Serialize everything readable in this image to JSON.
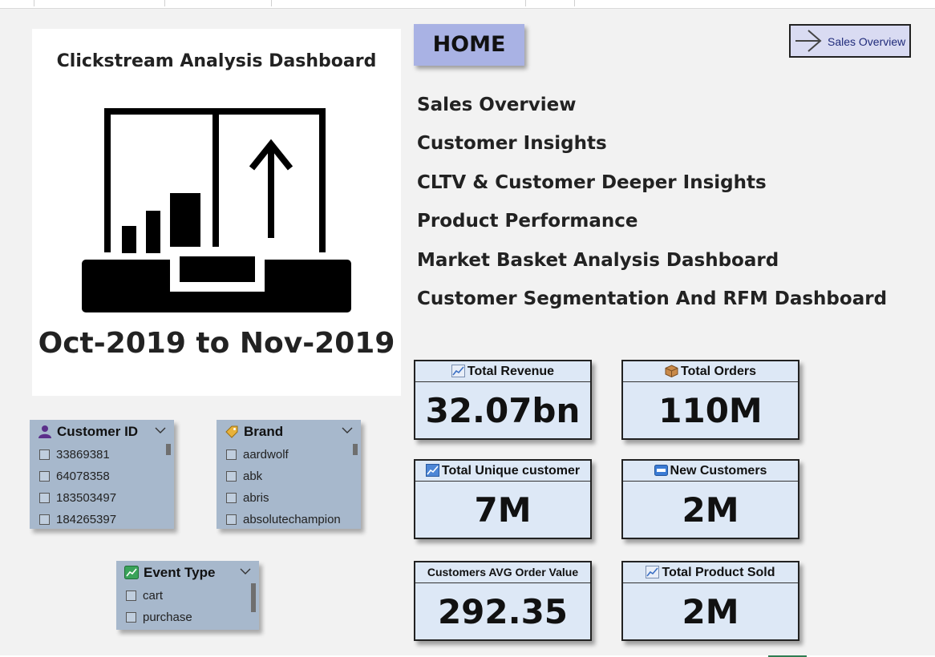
{
  "logo_card": {
    "title": "Clickstream Analysis Dashboard",
    "date_range": "Oct-2019 to Nov-2019",
    "logo_icon": "chart-growth-icon"
  },
  "home_label": "HOME",
  "nav_button": {
    "label": "Sales Overview",
    "icon": "arrow-right-icon"
  },
  "page_links": [
    "Sales Overview",
    "Customer Insights",
    "CLTV & Customer Deeper Insights",
    "Product Performance",
    "Market Basket Analysis Dashboard",
    "Customer Segmentation And RFM Dashboard"
  ],
  "kpis": [
    {
      "label": "Total Revenue",
      "value": "32.07bn",
      "icon": "chart-up-icon"
    },
    {
      "label": "Total Orders",
      "value": "110M",
      "icon": "package-icon"
    },
    {
      "label": "Total Unique customer",
      "value": "7M",
      "icon": "chart-up-icon"
    },
    {
      "label": "New Customers",
      "value": "2M",
      "icon": "new-badge-icon"
    },
    {
      "label": "Customers AVG Order Value",
      "value": "292.35",
      "icon": ""
    },
    {
      "label": "Total Product Sold",
      "value": "2M",
      "icon": "chart-up-icon"
    }
  ],
  "slicers": {
    "customer_id": {
      "title": "Customer ID",
      "icon": "user-icon",
      "items": [
        "33869381",
        "64078358",
        "183503497",
        "184265397"
      ]
    },
    "brand": {
      "title": "Brand",
      "icon": "tag-icon",
      "items": [
        "aardwolf",
        "abk",
        "abris",
        "absolutechampion"
      ]
    },
    "event_type": {
      "title": "Event Type",
      "icon": "chart-icon",
      "items": [
        "cart",
        "purchase"
      ]
    }
  },
  "colors": {
    "background": "#f2f2f2",
    "kpi_fill": "#dde8f6",
    "home_fill": "#a9b2e4",
    "slicer_fill": "#a7b8cc",
    "nav_text": "#1f2a7a"
  }
}
